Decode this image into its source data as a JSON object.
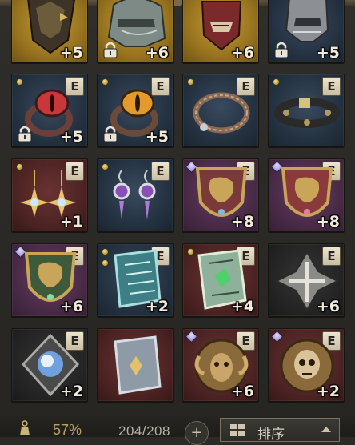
{
  "inventory": {
    "slots": [
      {
        "item": "dragon-helm",
        "level": "+5",
        "rarity": "gold",
        "equip": "",
        "locked": false
      },
      {
        "item": "steel-helm",
        "level": "+6",
        "rarity": "gold",
        "equip": "",
        "locked": true
      },
      {
        "item": "demon-mask-helm",
        "level": "+6",
        "rarity": "gold",
        "equip": "",
        "locked": false
      },
      {
        "item": "knight-helm",
        "level": "+5",
        "rarity": "blue",
        "equip": "",
        "locked": true
      },
      {
        "item": "red-eye-ring",
        "level": "+5",
        "rarity": "blue",
        "equip": "E",
        "locked": true
      },
      {
        "item": "amber-eye-ring",
        "level": "+5",
        "rarity": "blue",
        "equip": "E",
        "locked": true
      },
      {
        "item": "braided-bracelet",
        "level": "",
        "rarity": "blue",
        "equip": "E",
        "locked": false
      },
      {
        "item": "studded-belt",
        "level": "",
        "rarity": "blue",
        "equip": "E",
        "locked": false
      },
      {
        "item": "gold-star-earrings",
        "level": "+1",
        "rarity": "maroon",
        "equip": "E",
        "locked": false
      },
      {
        "item": "amethyst-earrings",
        "level": "",
        "rarity": "blue",
        "equip": "E",
        "locked": false
      },
      {
        "item": "lion-crest-shield",
        "level": "+8",
        "rarity": "purple",
        "equip": "E",
        "locked": false
      },
      {
        "item": "lion-crest-shield",
        "level": "+8",
        "rarity": "purple",
        "equip": "E",
        "locked": false
      },
      {
        "item": "lion-crest-shield",
        "level": "+6",
        "rarity": "purple",
        "equip": "E",
        "locked": false
      },
      {
        "item": "rune-tome",
        "level": "+2",
        "rarity": "blue",
        "equip": "E",
        "locked": false
      },
      {
        "item": "green-rune-tome",
        "level": "+4",
        "rarity": "maroon",
        "equip": "E",
        "locked": false
      },
      {
        "item": "bone-sigil",
        "level": "+6",
        "rarity": "dark",
        "equip": "E",
        "locked": false
      },
      {
        "item": "orb-amulet",
        "level": "+2",
        "rarity": "dark",
        "equip": "E",
        "locked": false
      },
      {
        "item": "silver-tome",
        "level": "",
        "rarity": "maroon",
        "equip": "",
        "locked": false
      },
      {
        "item": "ram-skull-relic",
        "level": "+6",
        "rarity": "maroon",
        "equip": "E",
        "locked": false
      },
      {
        "item": "skull-relic",
        "level": "+2",
        "rarity": "maroon",
        "equip": "E",
        "locked": false
      }
    ]
  },
  "footer": {
    "percent": "57%",
    "count": "204/208",
    "add_label": "+",
    "sort_label": "排序"
  },
  "colors": {
    "gold": "#98741f",
    "blue": "#243241",
    "purple": "#4a2b48",
    "maroon": "#4e2424",
    "dark": "#252525",
    "badge": "#ece4cf",
    "level_text": "#f1ead9"
  }
}
